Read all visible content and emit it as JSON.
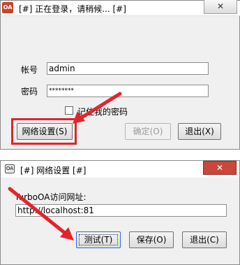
{
  "login_window": {
    "app_icon": "OA",
    "title": "[#] 正在登录，请稍候... [#]",
    "close_glyph": "✕",
    "account_label": "帐号",
    "account_value": "admin",
    "password_label": "密码",
    "password_value": "********",
    "remember_label": "记住我的密码",
    "network_button": "网络设置(S)",
    "ok_button": "确定(O)",
    "exit_button": "退出(X)"
  },
  "network_dialog": {
    "icon": "OA",
    "title": "[#] 网络设置 [#]",
    "close_glyph": "✕",
    "url_label": "TurboOA访问网址:",
    "url_value": "http://localhost:81",
    "test_button": "测试(T)",
    "save_button": "保存(O)",
    "exit_button": "退出(C)"
  },
  "colors": {
    "annotation_red": "#e3242b",
    "window_bg": "#f0f0f0",
    "close_red": "#c9473b"
  }
}
